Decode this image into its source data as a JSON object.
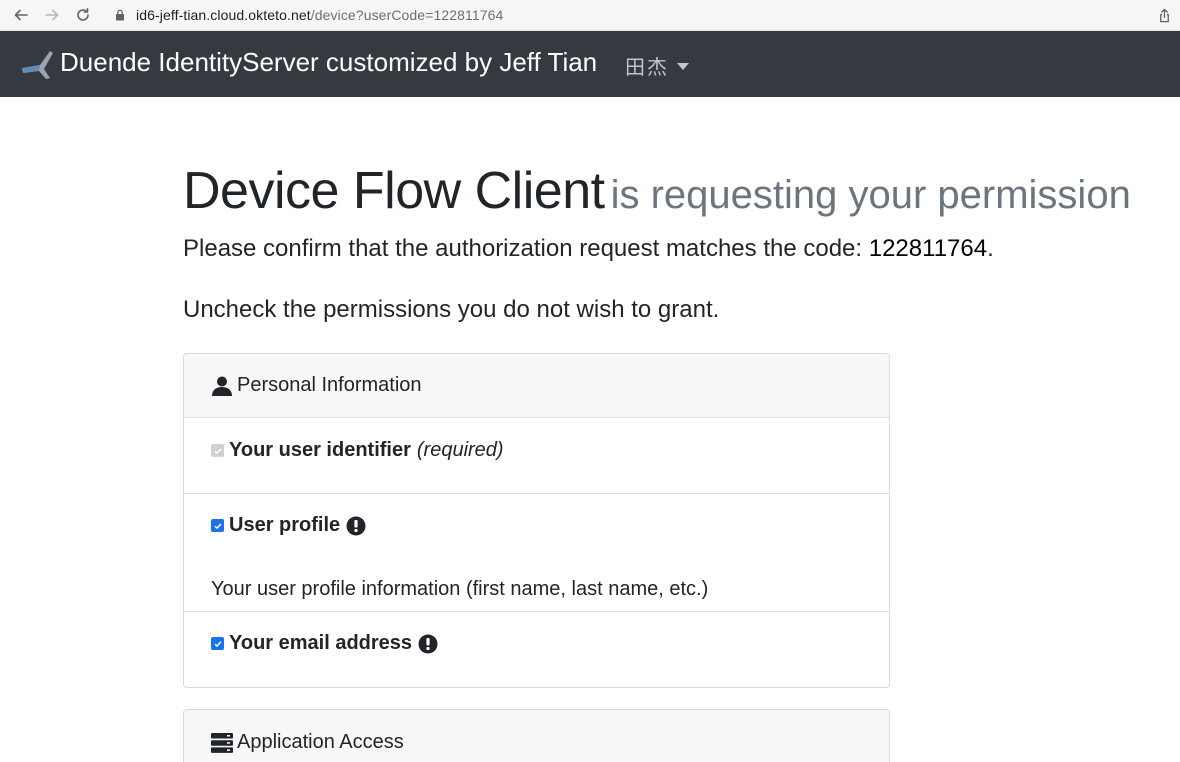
{
  "browser": {
    "url_host": "id6-jeff-tian.cloud.okteto.net",
    "url_path": "/device?userCode=122811764"
  },
  "navbar": {
    "brand": "Duende IdentityServer customized by Jeff Tian",
    "user_name": "田杰"
  },
  "consent": {
    "client_name": "Device Flow Client",
    "requesting_text": "is requesting your permission",
    "confirm_prefix": "Please confirm that the authorization request matches the code:",
    "user_code": "122811764",
    "confirm_suffix": ".",
    "uncheck_text": "Uncheck the permissions you do not wish to grant."
  },
  "identity_section": {
    "title": "Personal Information",
    "icon": "user-icon",
    "scopes": [
      {
        "name": "Your user identifier",
        "required_label": "(required)",
        "checked": true,
        "disabled": true,
        "emphasize": false,
        "description": ""
      },
      {
        "name": "User profile",
        "required_label": "",
        "checked": true,
        "disabled": false,
        "emphasize": true,
        "description": "Your user profile information (first name, last name, etc.)"
      },
      {
        "name": "Your email address",
        "required_label": "",
        "checked": true,
        "disabled": false,
        "emphasize": true,
        "description": ""
      }
    ]
  },
  "api_section": {
    "title": "Application Access",
    "icon": "server-icon"
  },
  "colors": {
    "navbar_bg": "#343a40",
    "checkbox_blue": "#1a73e8",
    "muted_text": "#6c757d"
  }
}
